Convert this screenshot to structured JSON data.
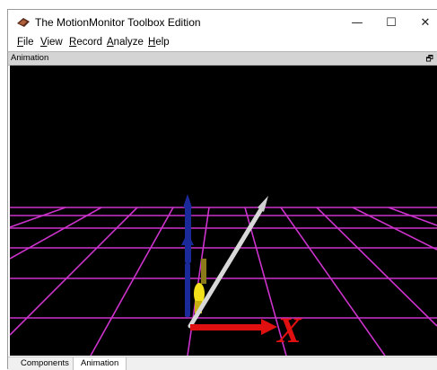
{
  "window": {
    "title": "The MotionMonitor Toolbox Edition",
    "minimize_glyph": "—",
    "maximize_glyph": "☐",
    "close_glyph": "✕"
  },
  "menu": {
    "items": [
      {
        "accel": "F",
        "rest": "ile"
      },
      {
        "accel": "V",
        "rest": "iew"
      },
      {
        "accel": "R",
        "rest": "ecord"
      },
      {
        "accel": "A",
        "rest": "nalyze"
      },
      {
        "accel": "H",
        "rest": "elp"
      }
    ]
  },
  "panel": {
    "title": "Animation",
    "restore_glyph": "🗗"
  },
  "scene": {
    "background_color": "#000000",
    "grid_color": "#cc33cc",
    "axis_y_color": "#1a2a9a",
    "axis_x_color": "#e01010",
    "axis_x_label": "X",
    "pointer_color": "#d8d8d8",
    "sensor_color": "#f2e01a"
  },
  "tabs": [
    {
      "label": "Components",
      "active": false
    },
    {
      "label": "Animation",
      "active": true
    }
  ]
}
